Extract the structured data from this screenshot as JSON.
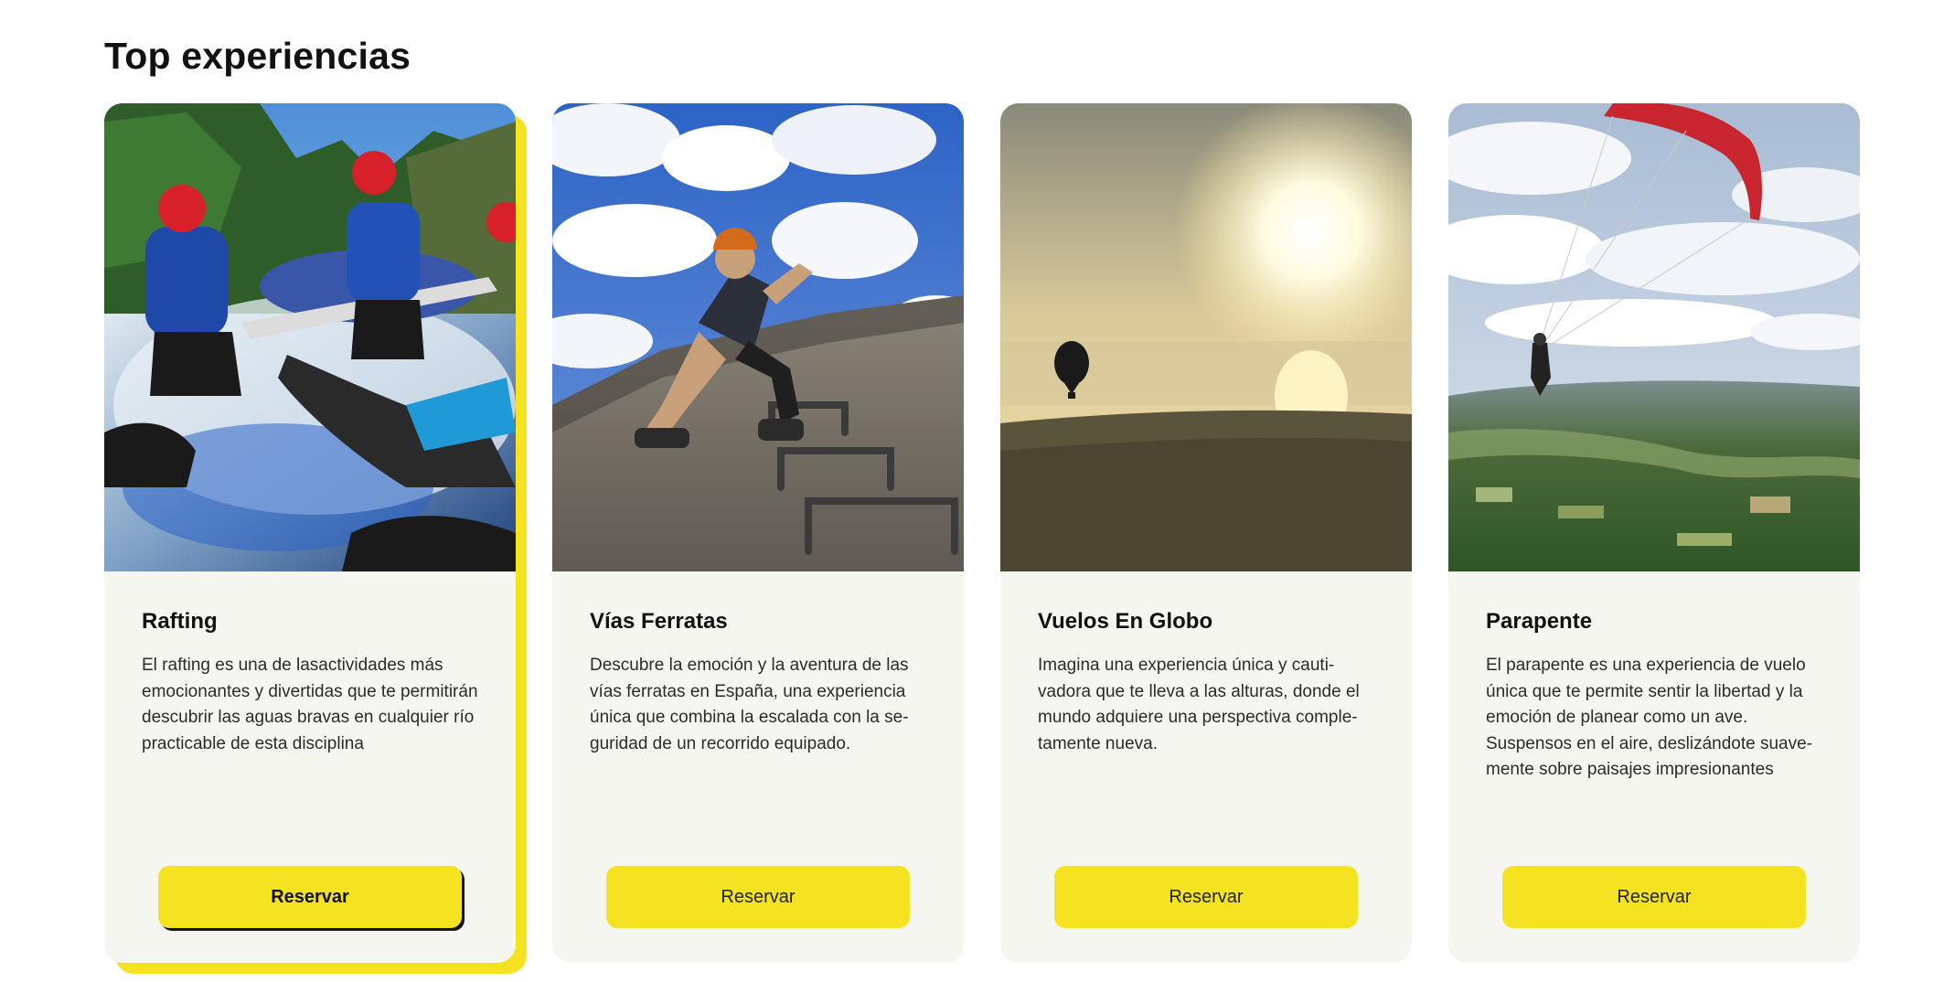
{
  "section": {
    "title": "Top experiencias"
  },
  "colors": {
    "accent": "#f5e322",
    "card_bg": "#f6f6f1",
    "text": "#111111"
  },
  "cards": [
    {
      "title": "Rafting",
      "description": "El rafting es una de lasactividades más emocionantes y divertidas que te permitirán descubrir las aguas bravas en cualquier río practicable de esta disciplina",
      "button_label": "Reservar",
      "image_subject": "rafting-photo"
    },
    {
      "title": "Vías Ferratas",
      "description": "Descubre la emoción y la aventura de las vías ferratas en España, una experiencia única que combina la escalada con la se-guridad de un recorrido equipado.",
      "button_label": "Reservar",
      "image_subject": "via-ferrata-photo"
    },
    {
      "title": "Vuelos En Globo",
      "description": "Imagina una experiencia única y cauti-vadora que te lleva a las alturas, donde el mundo adquiere una perspectiva comple-tamente nueva.",
      "button_label": "Reservar",
      "image_subject": "balloon-photo"
    },
    {
      "title": "Parapente",
      "description": "El parapente es una experiencia de vuelo única que te permite sentir la libertad y la emoción de planear como un ave. Suspensos en el aire, deslizándote suave-mente sobre paisajes impresionantes",
      "button_label": "Reservar",
      "image_subject": "paragliding-photo"
    }
  ]
}
